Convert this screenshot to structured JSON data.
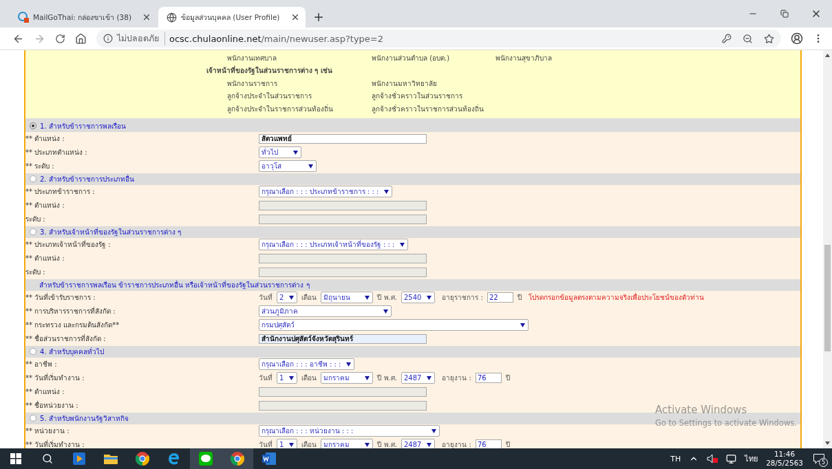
{
  "browser": {
    "tabs": [
      {
        "title": "MailGoThai: กล่องขาเข้า (38)",
        "selected": false
      },
      {
        "title": "ข้อมูลส่วนบุคคล (User Profile)",
        "selected": true
      }
    ],
    "security": "ไม่ปลอดภัย",
    "url_host": "ocsc.chulaonline.net",
    "url_path": "/main/newuser.asp?type=2"
  },
  "info_box": {
    "rows": [
      {
        "kind": "item",
        "cells": [
          "พนักงานเทศบาล",
          "พนักงานส่วนตำบล (อบต.)",
          "พนักงานสุขาภิบาล"
        ]
      },
      {
        "kind": "heading",
        "cells": [
          "เจ้าหน้าที่ของรัฐในส่วนราชการต่าง ๆ เช่น"
        ]
      },
      {
        "kind": "item",
        "cells": [
          "พนักงานราชการ",
          "พนักงานมหาวิทยาลัย"
        ]
      },
      {
        "kind": "item",
        "cells": [
          "ลูกจ้างประจำในส่วนราชการ",
          "ลูกจ้างชั่วคราวในส่วนราชการ"
        ]
      },
      {
        "kind": "item",
        "cells": [
          "ลูกจ้างประจำในราชการส่วนท้องถิ่น",
          "ลูกจ้างชั่วคราวในราชการส่วนท้องถิ่น"
        ]
      }
    ]
  },
  "sections": [
    {
      "kind": "option",
      "selected": true,
      "title": "1. สำหรับข้าราชการพลเรือน",
      "rows": [
        {
          "kind": "field",
          "label": "** ตำแหน่ง :",
          "value": "สัตวแพทย์",
          "disabled": false
        },
        {
          "kind": "select",
          "label": "** ประเภทตำแหน่ง :",
          "value": "ทั่วไป"
        },
        {
          "kind": "select",
          "label": "** ระดับ :",
          "value": "อาวุโส"
        }
      ]
    },
    {
      "kind": "option",
      "selected": false,
      "title": "2. สำหรับข้าราชการประเภทอื่น",
      "rows": [
        {
          "kind": "select",
          "label": "** ประเภทข้าราชการ :",
          "value": "กรุณาเลือก : : : ประเภทข้าราชการ : : :"
        },
        {
          "kind": "field",
          "label": "** ตำแหน่ง :",
          "disabled": true
        },
        {
          "kind": "field",
          "label": "ระดับ :",
          "disabled": true
        }
      ]
    },
    {
      "kind": "option",
      "selected": false,
      "title": "3. สำหรับเจ้าหน้าที่ของรัฐในส่วนราชการต่าง ๆ",
      "rows": [
        {
          "kind": "select",
          "label": "** ประเภทเจ้าหน้าที่ของรัฐ :",
          "value": "กรุณาเลือก : : : ประเภทเจ้าหน้าที่ของรัฐ : : :"
        },
        {
          "kind": "field",
          "label": "** ตำแหน่ง :",
          "disabled": true
        },
        {
          "kind": "field",
          "label": "ระดับ :",
          "disabled": true
        }
      ]
    },
    {
      "kind": "heading",
      "title": "สำหรับข้าราชการพลเรือน ข้าราชการประเภทอื่น หรือเจ้าหน้าที่ของรัฐในส่วนราชการต่าง ๆ",
      "rows": [
        {
          "kind": "date",
          "label": "** วันที่เข้ารับราชการ :",
          "day_label": "วันที่",
          "day": "2",
          "month_label": "เดือน",
          "month": "มิถุนายน",
          "year_label": "ปี พ.ศ.",
          "year": "2540",
          "age_label": "อายุราชการ :",
          "age": "22",
          "unit": "ปี",
          "note": "โปรดกรอกข้อมูลตรงตามความจริงเพื่อประโยชน์ของตัวท่าน"
        },
        {
          "kind": "select",
          "label": "** การบริหารราชการที่สังกัด :",
          "value": "ส่วนภูมิภาค"
        },
        {
          "kind": "select",
          "label": "** กระทรวง และกรมต้นสังกัด**",
          "value": "กรมปศุสัตว์"
        },
        {
          "kind": "field",
          "label": "** ชื่อส่วนราชการที่สังกัด :",
          "value": "สำนักงานปศุสัตว์จังหวัดสุรินทร์",
          "disabled": false,
          "autofilled": true
        }
      ]
    },
    {
      "kind": "option",
      "selected": false,
      "title": "4. สำหรับบุคคลทั่วไป",
      "rows": [
        {
          "kind": "select",
          "label": "** อาชีพ :",
          "value": "กรุณาเลือก : : : อาชีพ : : :"
        },
        {
          "kind": "date",
          "label": "** วันที่เริ่มทำงาน :",
          "day_label": "วันที่",
          "day": "1",
          "month_label": "เดือน",
          "month": "มกราคม",
          "year_label": "ปี พ.ศ.",
          "year": "2487",
          "age_label": "อายุงาน :",
          "age": "76",
          "unit": "ปี"
        },
        {
          "kind": "field",
          "label": "** ตำแหน่ง :",
          "disabled": true
        },
        {
          "kind": "field",
          "label": "** ชื่อหน่วยงาน :",
          "disabled": true
        }
      ]
    },
    {
      "kind": "option",
      "selected": false,
      "title": "5. สำหรับพนักงานรัฐวิสาหกิจ",
      "rows": [
        {
          "kind": "select",
          "label": "** หน่วยงาน :",
          "value": "กรุณาเลือก : : : หน่วยงาน : : :"
        },
        {
          "kind": "date",
          "label": "** วันที่เริ่มทำงาน :",
          "day_label": "วันที่",
          "day": "1",
          "month_label": "เดือน",
          "month": "มกราคม",
          "year_label": "ปี พ.ศ.",
          "year": "2487",
          "age_label": "อายุงาน :",
          "age": "76",
          "unit": "ปี"
        }
      ]
    }
  ],
  "os_notice": {
    "title": "Activate Windows",
    "text": "Go to Settings to activate Windows."
  },
  "taskbar": {
    "language": "TH",
    "keyboard": "ไทย",
    "time": "11:46",
    "date": "28/5/2563",
    "notifications": "5"
  }
}
